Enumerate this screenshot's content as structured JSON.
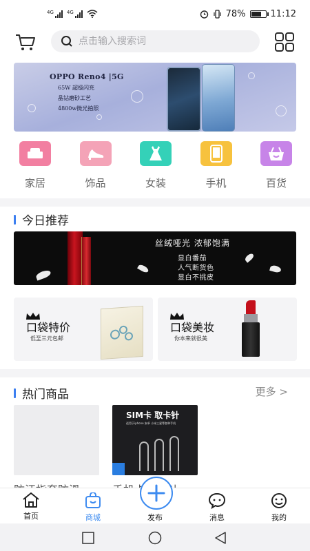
{
  "status_bar": {
    "network_1": "4G",
    "network_2": "4G",
    "battery_text": "78%",
    "battery_level": 0.78,
    "time": "11:12",
    "icons": [
      "signal-icon",
      "wifi-icon",
      "alarm-icon",
      "vibrate-icon",
      "battery-icon"
    ]
  },
  "header": {
    "search_placeholder": "点击输入搜索词",
    "icons": [
      "cart-icon",
      "search-icon",
      "grid-menu-icon"
    ]
  },
  "banner": {
    "title": "OPPO Reno4 |5G",
    "lines": [
      "65W 超级闪充",
      "晶钻磨砂工艺",
      "4800w微光拍照"
    ]
  },
  "categories": [
    {
      "label": "家居",
      "icon": "sofa-icon",
      "color": "#f27fa1"
    },
    {
      "label": "饰品",
      "icon": "high-heel-icon",
      "color": "#f4a3b7"
    },
    {
      "label": "女装",
      "icon": "dress-icon",
      "color": "#34d1b8"
    },
    {
      "label": "手机",
      "icon": "phone-icon",
      "color": "#f7c23e"
    },
    {
      "label": "百货",
      "icon": "basket-icon",
      "color": "#c784e8"
    }
  ],
  "recommend": {
    "title": "今日推荐",
    "promo": {
      "headline": "丝绒哑光  浓郁饱满",
      "lines": [
        "显白番茄",
        "人气断货色",
        "显白不挑皮"
      ]
    },
    "cards": [
      {
        "title": "口袋特价",
        "subtitle": "低至三元包邮"
      },
      {
        "title": "口袋美妆",
        "subtitle": "你本来就很美"
      }
    ]
  },
  "hot": {
    "title": "热门商品",
    "more": "更多 >",
    "products": [
      {
        "name": "防汗指套防滑",
        "image_text": ""
      },
      {
        "name": "手机卡取卡针",
        "image_title": "SIM卡 取卡针",
        "image_sub": "适用于iphone 安卓 小米三星等各种手机"
      }
    ]
  },
  "tabbar": {
    "tabs": [
      {
        "label": "首页",
        "icon": "home-icon",
        "active": false
      },
      {
        "label": "商城",
        "icon": "shop-bag-icon",
        "active": true
      },
      {
        "label": "发布",
        "icon": "plus-icon",
        "active": false
      },
      {
        "label": "消息",
        "icon": "message-icon",
        "active": false
      },
      {
        "label": "我的",
        "icon": "profile-icon",
        "active": false
      }
    ],
    "accent": "#3d8bf0"
  },
  "system_nav": [
    "square-icon",
    "circle-icon",
    "back-triangle-icon"
  ]
}
